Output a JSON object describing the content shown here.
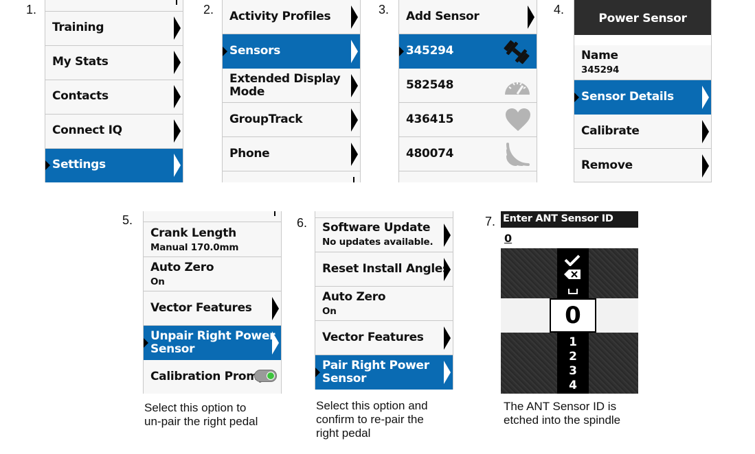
{
  "steps": [
    "1.",
    "2.",
    "3.",
    "4.",
    "5.",
    "6.",
    "7."
  ],
  "screen1": {
    "items": [
      "Training",
      "My Stats",
      "Contacts",
      "Connect IQ",
      "Settings"
    ]
  },
  "screen2": {
    "items": [
      "Activity Profiles",
      "Sensors",
      "Extended Display",
      "Mode",
      "GroupTrack",
      "Phone"
    ]
  },
  "screen3": {
    "items": [
      "Add Sensor",
      "345294",
      "582548",
      "436415",
      "480074"
    ],
    "icons": [
      "dumbbell-icon",
      "speedometer-icon",
      "heart-icon",
      "ant-signal-icon"
    ]
  },
  "screen4": {
    "header": "Power Sensor",
    "name_label": "Name",
    "name_value": "345294",
    "items": [
      "Sensor Details",
      "Calibrate",
      "Remove"
    ]
  },
  "screen5": {
    "crank_label": "Crank Length",
    "crank_value": "Manual 170.0mm",
    "autozero_label": "Auto Zero",
    "autozero_value": "On",
    "vector_label": "Vector Features",
    "unpair_line1": "Unpair Right Power",
    "unpair_line2": "Sensor",
    "calibration_label": "Calibration Prompt"
  },
  "screen6": {
    "software_label": "Software Update",
    "software_value": "No updates available.",
    "reset_label": "Reset Install Angles",
    "autozero_label": "Auto Zero",
    "autozero_value": "On",
    "vector_label": "Vector Features",
    "pair_line1": "Pair Right Power",
    "pair_line2": "Sensor"
  },
  "screen7": {
    "title": "Enter ANT Sensor ID",
    "entry": "0",
    "picker_selected": "0",
    "picker_below": [
      "1",
      "2",
      "3",
      "4"
    ]
  },
  "captions": {
    "c5": [
      "Select this option to",
      "un-pair the right pedal"
    ],
    "c6": [
      "Select this option and",
      "confirm to re-pair the",
      "right pedal"
    ],
    "c7": [
      "The ANT Sensor ID is",
      "etched into the spindle"
    ]
  },
  "colors": {
    "selected": "#0a6bb3",
    "header": "#2d2d2d",
    "toggle_on": "#3ec33e"
  }
}
